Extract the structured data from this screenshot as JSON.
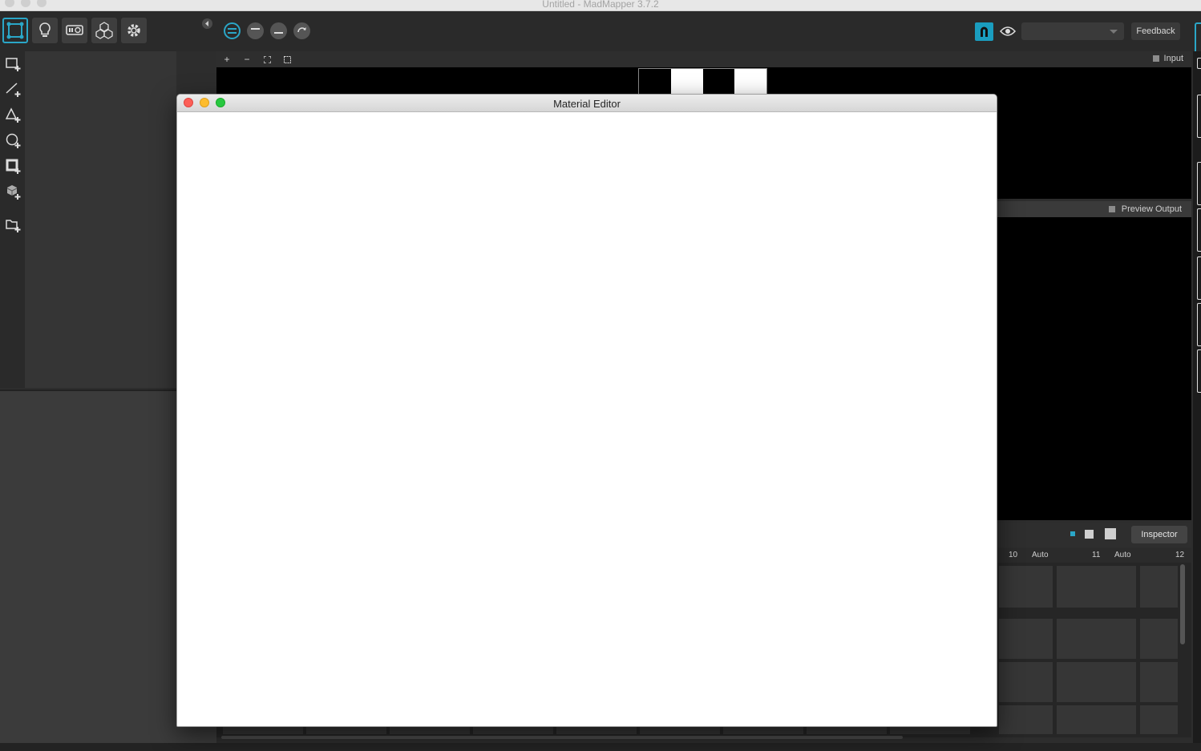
{
  "app": {
    "window_title": "Untitled - MadMapper 3.7.2"
  },
  "toolbar": {
    "feedback_label": "Feedback",
    "dropdown_value": ""
  },
  "input_panel": {
    "label": "Input"
  },
  "preview_panel": {
    "label": "Preview Output"
  },
  "inspector": {
    "button_label": "Inspector"
  },
  "columns": {
    "col10": "10",
    "col10_mode": "Auto",
    "col11": "11",
    "col11_mode": "Auto",
    "col12": "12"
  },
  "material_editor": {
    "title": "Material Editor"
  },
  "colors": {
    "accent": "#2aa6c7",
    "background": "#2d2d2d"
  },
  "icons": {
    "top": [
      "surfaces-icon",
      "lights-icon",
      "projector-icon",
      "cubes-icon",
      "gear-icon"
    ],
    "left": [
      "add-quad-icon",
      "add-line-icon",
      "add-triangle-icon",
      "add-circle-icon",
      "add-mask-icon",
      "add-3d-icon",
      "add-folder-icon"
    ]
  }
}
